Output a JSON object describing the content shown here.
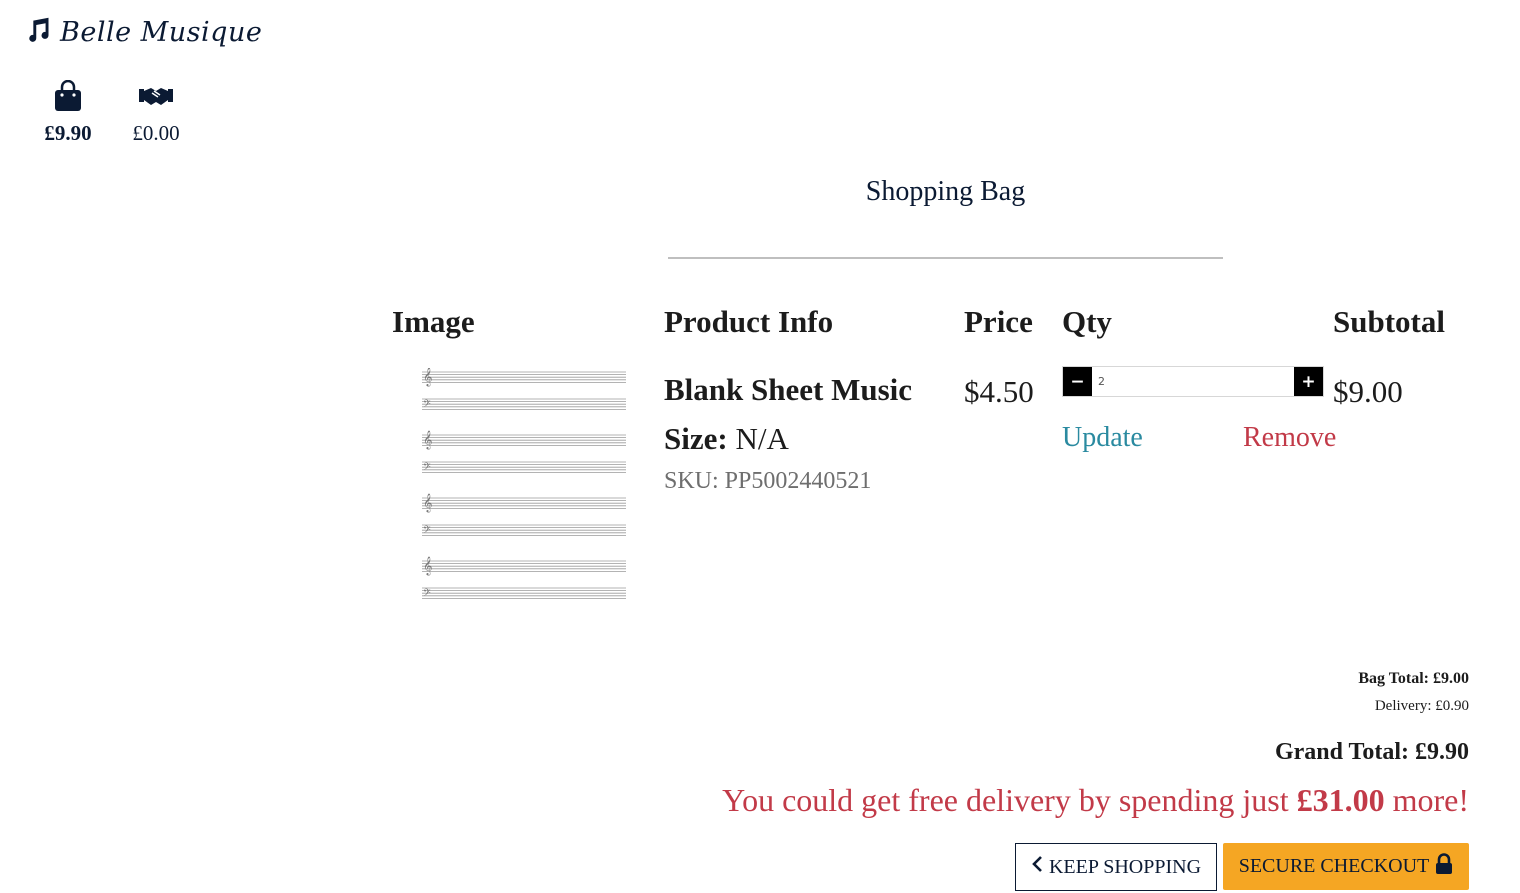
{
  "brand": {
    "name": "Belle Musique",
    "icon": "music-note-icon"
  },
  "nav": {
    "bag": {
      "icon": "shopping-bag-icon",
      "amount": "£9.90"
    },
    "deals": {
      "icon": "handshake-icon",
      "amount": "£0.00"
    }
  },
  "page": {
    "title": "Shopping Bag"
  },
  "table": {
    "headers": [
      "Image",
      "Product Info",
      "Price",
      "Qty",
      "Subtotal"
    ]
  },
  "product": {
    "name": "Blank Sheet Music",
    "size_label": "Size:",
    "size_value": "N/A",
    "sku": "SKU: PP5002440521",
    "price": "$4.50",
    "quantity": "2",
    "subtotal": "$9.00",
    "update_label": "Update",
    "remove_label": "Remove",
    "image": "blank-sheet-music-image"
  },
  "totals": {
    "bag_total": "Bag Total: £9.00",
    "delivery": "Delivery: £0.90",
    "grand_total": "Grand Total: £9.90",
    "free_delivery_prefix": "You could get free delivery by spending just",
    "free_delivery_amount": "£31.00",
    "free_delivery_suffix": "more!"
  },
  "actions": {
    "keep_shopping": "KEEP SHOPPING",
    "secure_checkout": "SECURE CHECKOUT"
  },
  "colors": {
    "navy": "#0b1a33",
    "accent_red": "#c23a48",
    "accent_teal": "#2a8aa0",
    "checkout_orange": "#f5a623"
  }
}
